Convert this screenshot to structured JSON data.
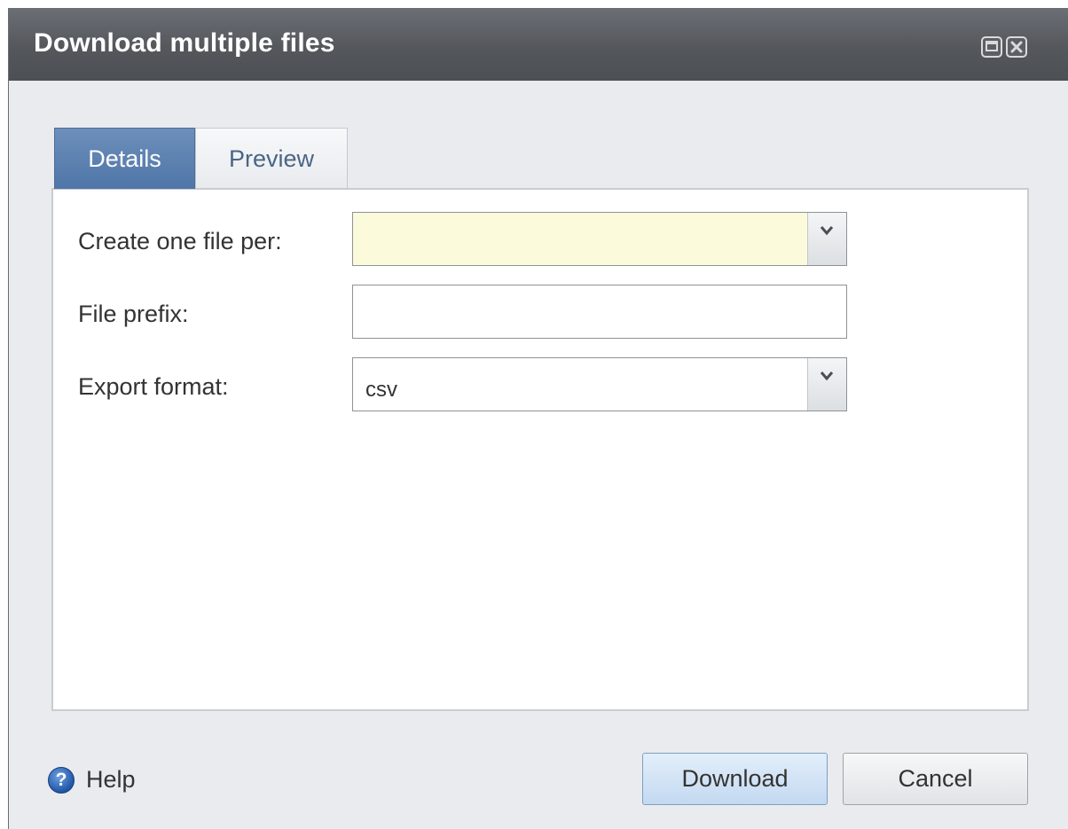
{
  "dialog": {
    "title": "Download multiple files"
  },
  "tabs": [
    {
      "label": "Details",
      "active": true
    },
    {
      "label": "Preview",
      "active": false
    }
  ],
  "fields": {
    "create_one_file_per": {
      "label": "Create one file per:",
      "value": ""
    },
    "file_prefix": {
      "label": "File prefix:",
      "value": ""
    },
    "export_format": {
      "label": "Export format:",
      "value": "csv"
    }
  },
  "footer": {
    "help_label": "Help",
    "download_label": "Download",
    "cancel_label": "Cancel"
  },
  "colors": {
    "titlebar": "#54575c",
    "active_tab": "#5a7fb0",
    "required_field": "#fbfbdc"
  },
  "icons": [
    "maximize-icon",
    "close-icon",
    "chevron-down-icon",
    "help-icon"
  ]
}
